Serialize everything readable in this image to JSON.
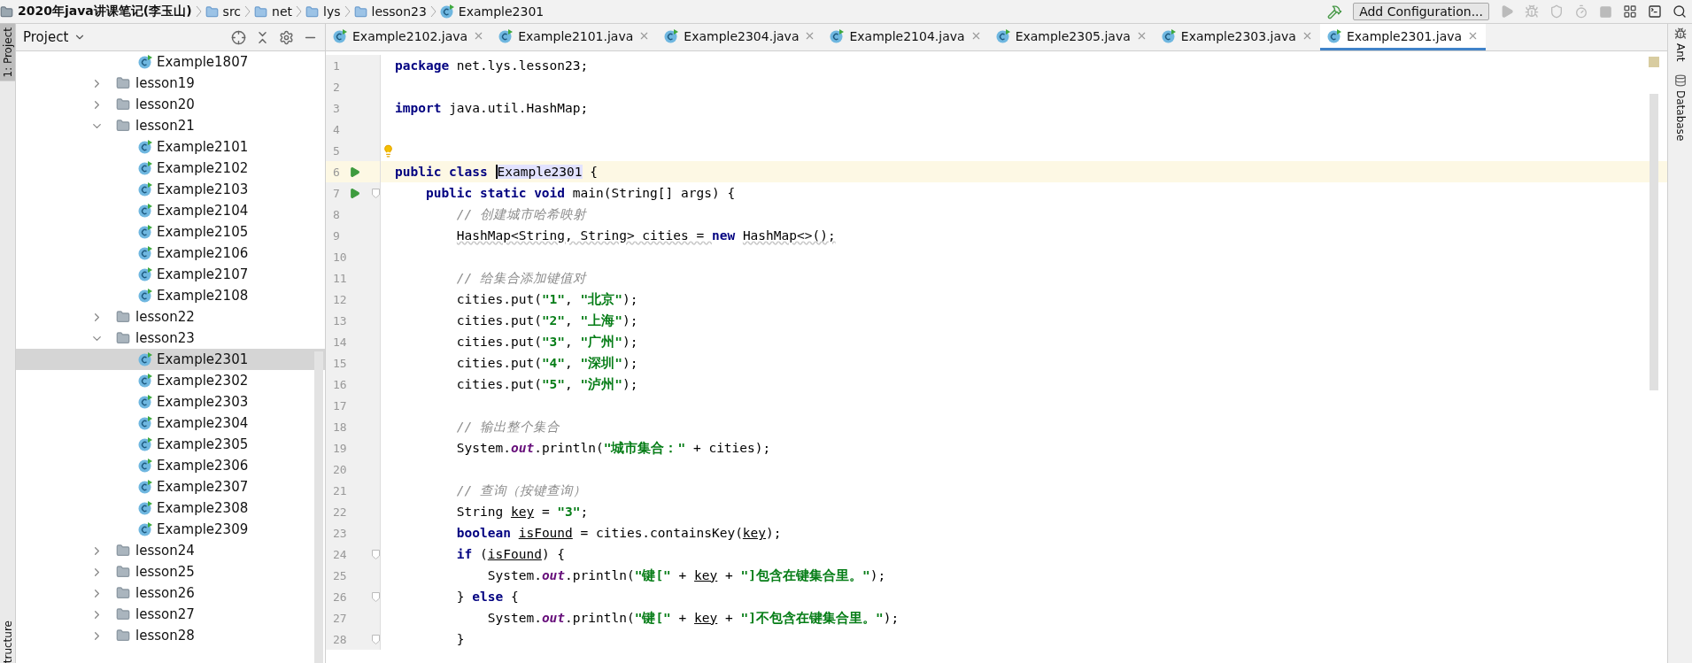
{
  "breadcrumbs": [
    {
      "kind": "project",
      "label": "2020年java讲课笔记(李玉山)"
    },
    {
      "kind": "folder",
      "label": "src"
    },
    {
      "kind": "folder",
      "label": "net"
    },
    {
      "kind": "folder",
      "label": "lys"
    },
    {
      "kind": "folder",
      "label": "lesson23"
    },
    {
      "kind": "class",
      "label": "Example2301"
    }
  ],
  "toolbar": {
    "run_config": "Add Configuration..."
  },
  "left_stripe": {
    "top": "1: Project",
    "bottom": "tructure"
  },
  "right_stripe": [
    {
      "kind": "ant",
      "label": "Ant"
    },
    {
      "kind": "database",
      "label": "Database"
    }
  ],
  "project_panel": {
    "title": "Project",
    "tree": [
      {
        "kind": "class",
        "label": "Example1807",
        "selected": false
      },
      {
        "kind": "folder",
        "label": "lesson19",
        "expanded": false
      },
      {
        "kind": "folder",
        "label": "lesson20",
        "expanded": false
      },
      {
        "kind": "folder",
        "label": "lesson21",
        "expanded": true,
        "children": [
          {
            "kind": "class",
            "label": "Example2101",
            "selected": false
          },
          {
            "kind": "class",
            "label": "Example2102",
            "selected": false
          },
          {
            "kind": "class",
            "label": "Example2103",
            "selected": false
          },
          {
            "kind": "class",
            "label": "Example2104",
            "selected": false
          },
          {
            "kind": "class",
            "label": "Example2105",
            "selected": false
          },
          {
            "kind": "class",
            "label": "Example2106",
            "selected": false
          },
          {
            "kind": "class",
            "label": "Example2107",
            "selected": false
          },
          {
            "kind": "class",
            "label": "Example2108",
            "selected": false
          }
        ]
      },
      {
        "kind": "folder",
        "label": "lesson22",
        "expanded": false
      },
      {
        "kind": "folder",
        "label": "lesson23",
        "expanded": true,
        "children": [
          {
            "kind": "class",
            "label": "Example2301",
            "selected": true
          },
          {
            "kind": "class",
            "label": "Example2302",
            "selected": false
          },
          {
            "kind": "class",
            "label": "Example2303",
            "selected": false
          },
          {
            "kind": "class",
            "label": "Example2304",
            "selected": false
          },
          {
            "kind": "class",
            "label": "Example2305",
            "selected": false
          },
          {
            "kind": "class",
            "label": "Example2306",
            "selected": false
          },
          {
            "kind": "class",
            "label": "Example2307",
            "selected": false
          },
          {
            "kind": "class",
            "label": "Example2308",
            "selected": false
          },
          {
            "kind": "class",
            "label": "Example2309",
            "selected": false
          }
        ]
      },
      {
        "kind": "folder",
        "label": "lesson24",
        "expanded": false
      },
      {
        "kind": "folder",
        "label": "lesson25",
        "expanded": false
      },
      {
        "kind": "folder",
        "label": "lesson26",
        "expanded": false
      },
      {
        "kind": "folder",
        "label": "lesson27",
        "expanded": false
      },
      {
        "kind": "folder",
        "label": "lesson28",
        "expanded": false
      }
    ]
  },
  "tabs": [
    {
      "label": "Example2102.java",
      "selected": false
    },
    {
      "label": "Example2101.java",
      "selected": false
    },
    {
      "label": "Example2304.java",
      "selected": false
    },
    {
      "label": "Example2104.java",
      "selected": false
    },
    {
      "label": "Example2305.java",
      "selected": false
    },
    {
      "label": "Example2303.java",
      "selected": false
    },
    {
      "label": "Example2301.java",
      "selected": true
    }
  ],
  "editor": {
    "lines": [
      {
        "number": "1",
        "tokens": [
          {
            "kind": "keyword",
            "text": "package"
          },
          {
            "kind": "plain",
            "text": " net.lys.lesson23;"
          }
        ]
      },
      {
        "number": "2"
      },
      {
        "number": "3",
        "tokens": [
          {
            "kind": "keyword",
            "text": "import"
          },
          {
            "kind": "plain",
            "text": " java.util.HashMap;"
          }
        ]
      },
      {
        "number": "4"
      },
      {
        "number": "5",
        "gutter": [
          {
            "kind": "bulb"
          }
        ]
      },
      {
        "number": "6",
        "caret_line": true,
        "gutter": [
          {
            "kind": "run"
          }
        ],
        "tokens": [
          {
            "kind": "keyword",
            "text": "public class "
          },
          {
            "kind": "highlight",
            "text": "Example2301"
          },
          {
            "kind": "plain",
            "text": " {"
          }
        ]
      },
      {
        "number": "7",
        "gutter": [
          {
            "kind": "run"
          },
          {
            "kind": "fold"
          }
        ],
        "tokens": [
          {
            "kind": "keyword",
            "text": "    public static void"
          },
          {
            "kind": "plain",
            "text": " main(String[] args) {"
          }
        ]
      },
      {
        "number": "8",
        "tokens": [
          {
            "kind": "comment",
            "text": "        // 创建城市哈希映射"
          }
        ]
      },
      {
        "number": "9",
        "tokens": [
          {
            "kind": "warning",
            "text": "        HashMap<String, String> cities = "
          },
          {
            "kind": "keyword",
            "text": "new"
          },
          {
            "kind": "warning",
            "text": " HashMap<>();"
          }
        ]
      },
      {
        "number": "10"
      },
      {
        "number": "11",
        "tokens": [
          {
            "kind": "comment",
            "text": "        // 给集合添加键值对"
          }
        ]
      },
      {
        "number": "12",
        "tokens": [
          {
            "kind": "plain",
            "text": "        cities.put("
          },
          {
            "kind": "string",
            "text": "\"1\""
          },
          {
            "kind": "plain",
            "text": ", "
          },
          {
            "kind": "string",
            "text": "\"北京\""
          },
          {
            "kind": "plain",
            "text": ");"
          }
        ]
      },
      {
        "number": "13",
        "tokens": [
          {
            "kind": "plain",
            "text": "        cities.put("
          },
          {
            "kind": "string",
            "text": "\"2\""
          },
          {
            "kind": "plain",
            "text": ", "
          },
          {
            "kind": "string",
            "text": "\"上海\""
          },
          {
            "kind": "plain",
            "text": ");"
          }
        ]
      },
      {
        "number": "14",
        "tokens": [
          {
            "kind": "plain",
            "text": "        cities.put("
          },
          {
            "kind": "string",
            "text": "\"3\""
          },
          {
            "kind": "plain",
            "text": ", "
          },
          {
            "kind": "string",
            "text": "\"广州\""
          },
          {
            "kind": "plain",
            "text": ");"
          }
        ]
      },
      {
        "number": "15",
        "tokens": [
          {
            "kind": "plain",
            "text": "        cities.put("
          },
          {
            "kind": "string",
            "text": "\"4\""
          },
          {
            "kind": "plain",
            "text": ", "
          },
          {
            "kind": "string",
            "text": "\"深圳\""
          },
          {
            "kind": "plain",
            "text": ");"
          }
        ]
      },
      {
        "number": "16",
        "tokens": [
          {
            "kind": "plain",
            "text": "        cities.put("
          },
          {
            "kind": "string",
            "text": "\"5\""
          },
          {
            "kind": "plain",
            "text": ", "
          },
          {
            "kind": "string",
            "text": "\"泸州\""
          },
          {
            "kind": "plain",
            "text": ");"
          }
        ]
      },
      {
        "number": "17"
      },
      {
        "number": "18",
        "tokens": [
          {
            "kind": "comment",
            "text": "        // 输出整个集合"
          }
        ]
      },
      {
        "number": "19",
        "tokens": [
          {
            "kind": "plain",
            "text": "        System."
          },
          {
            "kind": "field",
            "text": "out"
          },
          {
            "kind": "plain",
            "text": ".println("
          },
          {
            "kind": "string",
            "text": "\"城市集合：\""
          },
          {
            "kind": "plain",
            "text": " + cities);"
          }
        ]
      },
      {
        "number": "20"
      },
      {
        "number": "21",
        "tokens": [
          {
            "kind": "comment",
            "text": "        // 查询（按键查询）"
          }
        ]
      },
      {
        "number": "22",
        "tokens": [
          {
            "kind": "plain",
            "text": "        String "
          },
          {
            "kind": "underlined",
            "text": "key"
          },
          {
            "kind": "plain",
            "text": " = "
          },
          {
            "kind": "string",
            "text": "\"3\""
          },
          {
            "kind": "plain",
            "text": ";"
          }
        ]
      },
      {
        "number": "23",
        "tokens": [
          {
            "kind": "keyword",
            "text": "        boolean "
          },
          {
            "kind": "underlined",
            "text": "isFound"
          },
          {
            "kind": "plain",
            "text": " = cities.containsKey("
          },
          {
            "kind": "underlined",
            "text": "key"
          },
          {
            "kind": "plain",
            "text": ");"
          }
        ]
      },
      {
        "number": "24",
        "gutter": [
          {
            "kind": "fold"
          }
        ],
        "tokens": [
          {
            "kind": "keyword",
            "text": "        if"
          },
          {
            "kind": "plain",
            "text": " ("
          },
          {
            "kind": "underlined",
            "text": "isFound"
          },
          {
            "kind": "plain",
            "text": ") {"
          }
        ]
      },
      {
        "number": "25",
        "tokens": [
          {
            "kind": "plain",
            "text": "            System."
          },
          {
            "kind": "field",
            "text": "out"
          },
          {
            "kind": "plain",
            "text": ".println("
          },
          {
            "kind": "string",
            "text": "\"键[\""
          },
          {
            "kind": "plain",
            "text": " + "
          },
          {
            "kind": "underlined",
            "text": "key"
          },
          {
            "kind": "plain",
            "text": " + "
          },
          {
            "kind": "string",
            "text": "\"]包含在键集合里。\""
          },
          {
            "kind": "plain",
            "text": ");"
          }
        ]
      },
      {
        "number": "26",
        "gutter": [
          {
            "kind": "fold"
          }
        ],
        "tokens": [
          {
            "kind": "plain",
            "text": "        } "
          },
          {
            "kind": "keyword",
            "text": "else"
          },
          {
            "kind": "plain",
            "text": " {"
          }
        ]
      },
      {
        "number": "27",
        "tokens": [
          {
            "kind": "plain",
            "text": "            System."
          },
          {
            "kind": "field",
            "text": "out"
          },
          {
            "kind": "plain",
            "text": ".println("
          },
          {
            "kind": "string",
            "text": "\"键[\""
          },
          {
            "kind": "plain",
            "text": " + "
          },
          {
            "kind": "underlined",
            "text": "key"
          },
          {
            "kind": "plain",
            "text": " + "
          },
          {
            "kind": "string",
            "text": "\"]不包含在键集合里。\""
          },
          {
            "kind": "plain",
            "text": ");"
          }
        ]
      },
      {
        "number": "28",
        "gutter": [
          {
            "kind": "fold"
          }
        ],
        "tokens": [
          {
            "kind": "plain",
            "text": "        }"
          }
        ]
      }
    ]
  }
}
